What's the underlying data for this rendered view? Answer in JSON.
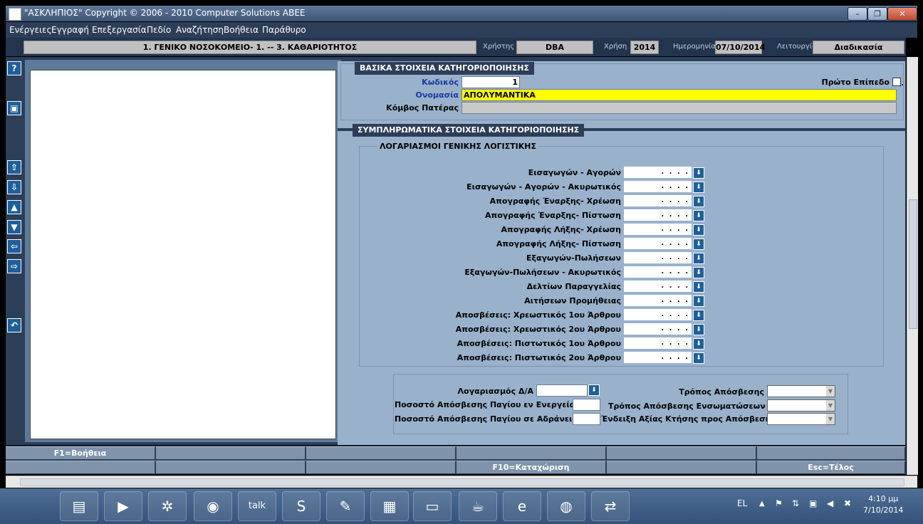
{
  "window": {
    "title": "\"ΑΣΚΛΗΠΙΟΣ\" Copyright © 2006 - 2010 Computer Solutions ABEE",
    "min_label": "–",
    "max_label": "❐",
    "close_label": "✕"
  },
  "menu": [
    "Ενέργειες",
    "Εγγραφή",
    "Επεξεργασία",
    "Πεδίο",
    "Αναζήτηση",
    "Βοήθεια",
    "Παράθυρο"
  ],
  "info": {
    "entity": "1. ΓΕΝΙΚΟ ΝΟΣΟΚΟΜΕΙΟ- 1. -- 3. ΚΑΘΑΡΙΟΤΗΤΟΣ",
    "user_label": "Χρήστης",
    "user": "DBA",
    "year_label": "Χρήση",
    "year": "2014",
    "date_label": "Ημερομηνία",
    "date": "07/10/2014",
    "function_label": "Λειτουργία",
    "function": "Διαδικασία"
  },
  "sidebar": {
    "help": "?",
    "save": "▣",
    "first": "⇧",
    "last": "⇩",
    "prev": "▲",
    "next": "▼",
    "left": "⇦",
    "right": "⇨",
    "undo": "↶"
  },
  "basic": {
    "section_title": "ΒΑΣΙΚΑ ΣΤΟΙΧΕΙΑ ΚΑΤΗΓΟΡΙΟΠΟΙΗΣΗΣ",
    "code_label": "Κωδικός",
    "code_value": "1",
    "first_level_label": "Πρώτο Επίπεδο",
    "first_level_suffix": ".",
    "name_label": "Ονομασία",
    "name_value": "ΑΠΟΛΥΜΑΝΤΙΚΑ",
    "parent_label": "Κόμβος Πατέρας",
    "parent_value": ""
  },
  "supplementary": {
    "section_title": "ΣΥΜΠΛΗΡΩΜΑΤΙΚΑ ΣΤΟΙΧΕΙΑ ΚΑΤΗΓΟΡΙΟΠΟΙΗΣΗΣ",
    "group_title": "ΛΟΓΑΡΙΑΣΜΟΙ ΓΕΝΙΚΗΣ ΛΟΓΙΣΤΙΚΗΣ",
    "account_mask": ". . . .",
    "accounts": [
      "Εισαγωγών - Αγορών",
      "Εισαγωγών - Αγορών  - Ακυρωτικός",
      "Απογραφής Έναρξης- Χρέωση",
      "Απογραφής Έναρξης- Πίστωση",
      "Απογραφής Λήξης- Χρέωση",
      "Απογραφής Λήξης- Πίστωση",
      "Εξαγωγών-Πωλήσεων",
      "Εξαγωγών-Πωλήσεων - Ακυρωτικός",
      "Δελτίων Παραγγελίας",
      "Αιτήσεων Προμήθειας",
      "Αποσβέσεις: Χρεωστικός 1ου Άρθρου",
      "Αποσβέσεις: Χρεωστικός 2ου Άρθρου",
      "Αποσβέσεις: Πιστωτικός 1ου Άρθρου",
      "Αποσβέσεις: Πιστωτικός 2ου Άρθρου"
    ]
  },
  "depreciation": {
    "account_label": "Λογαριασμός Δ/Α",
    "pct_active_label": "Ποσοστό Απόσβεσης Παγίου εν Ενεργεία",
    "pct_idle_label": "Ποσοστό Απόσβεσης Παγίου σε Αδράνεια",
    "method_label": "Τρόπος Απόσβεσης",
    "embedded_method_label": "Τρόπος Απόσβεσης Ενσωματώσεων",
    "value_indication_label": "Ένδειξη Αξίας Κτήσης προς Απόσβεση"
  },
  "fkeys": {
    "row1": [
      "F1=Βοήθεια",
      "",
      "",
      "",
      "",
      ""
    ],
    "row2": [
      "",
      "",
      "",
      "F10=Καταχώριση",
      "",
      "Esc=Τέλος"
    ]
  },
  "taskbar": {
    "icons": [
      "file-explorer-icon",
      "media-player-icon",
      "network-icon",
      "chrome-icon",
      "talk-icon",
      "skype-icon",
      "sticky-notes-icon",
      "calculator-icon",
      "notepad-icon",
      "java-icon",
      "ie-icon",
      "firefox-icon",
      "teamviewer-icon"
    ],
    "icon_glyphs": [
      "▤",
      "▶",
      "✲",
      "◉",
      "talk",
      "S",
      "✎",
      "▦",
      "▭",
      "☕",
      "e",
      "◍",
      "⇄"
    ],
    "lang": "EL",
    "time": "4:10 μμ",
    "date": "7/10/2014"
  }
}
